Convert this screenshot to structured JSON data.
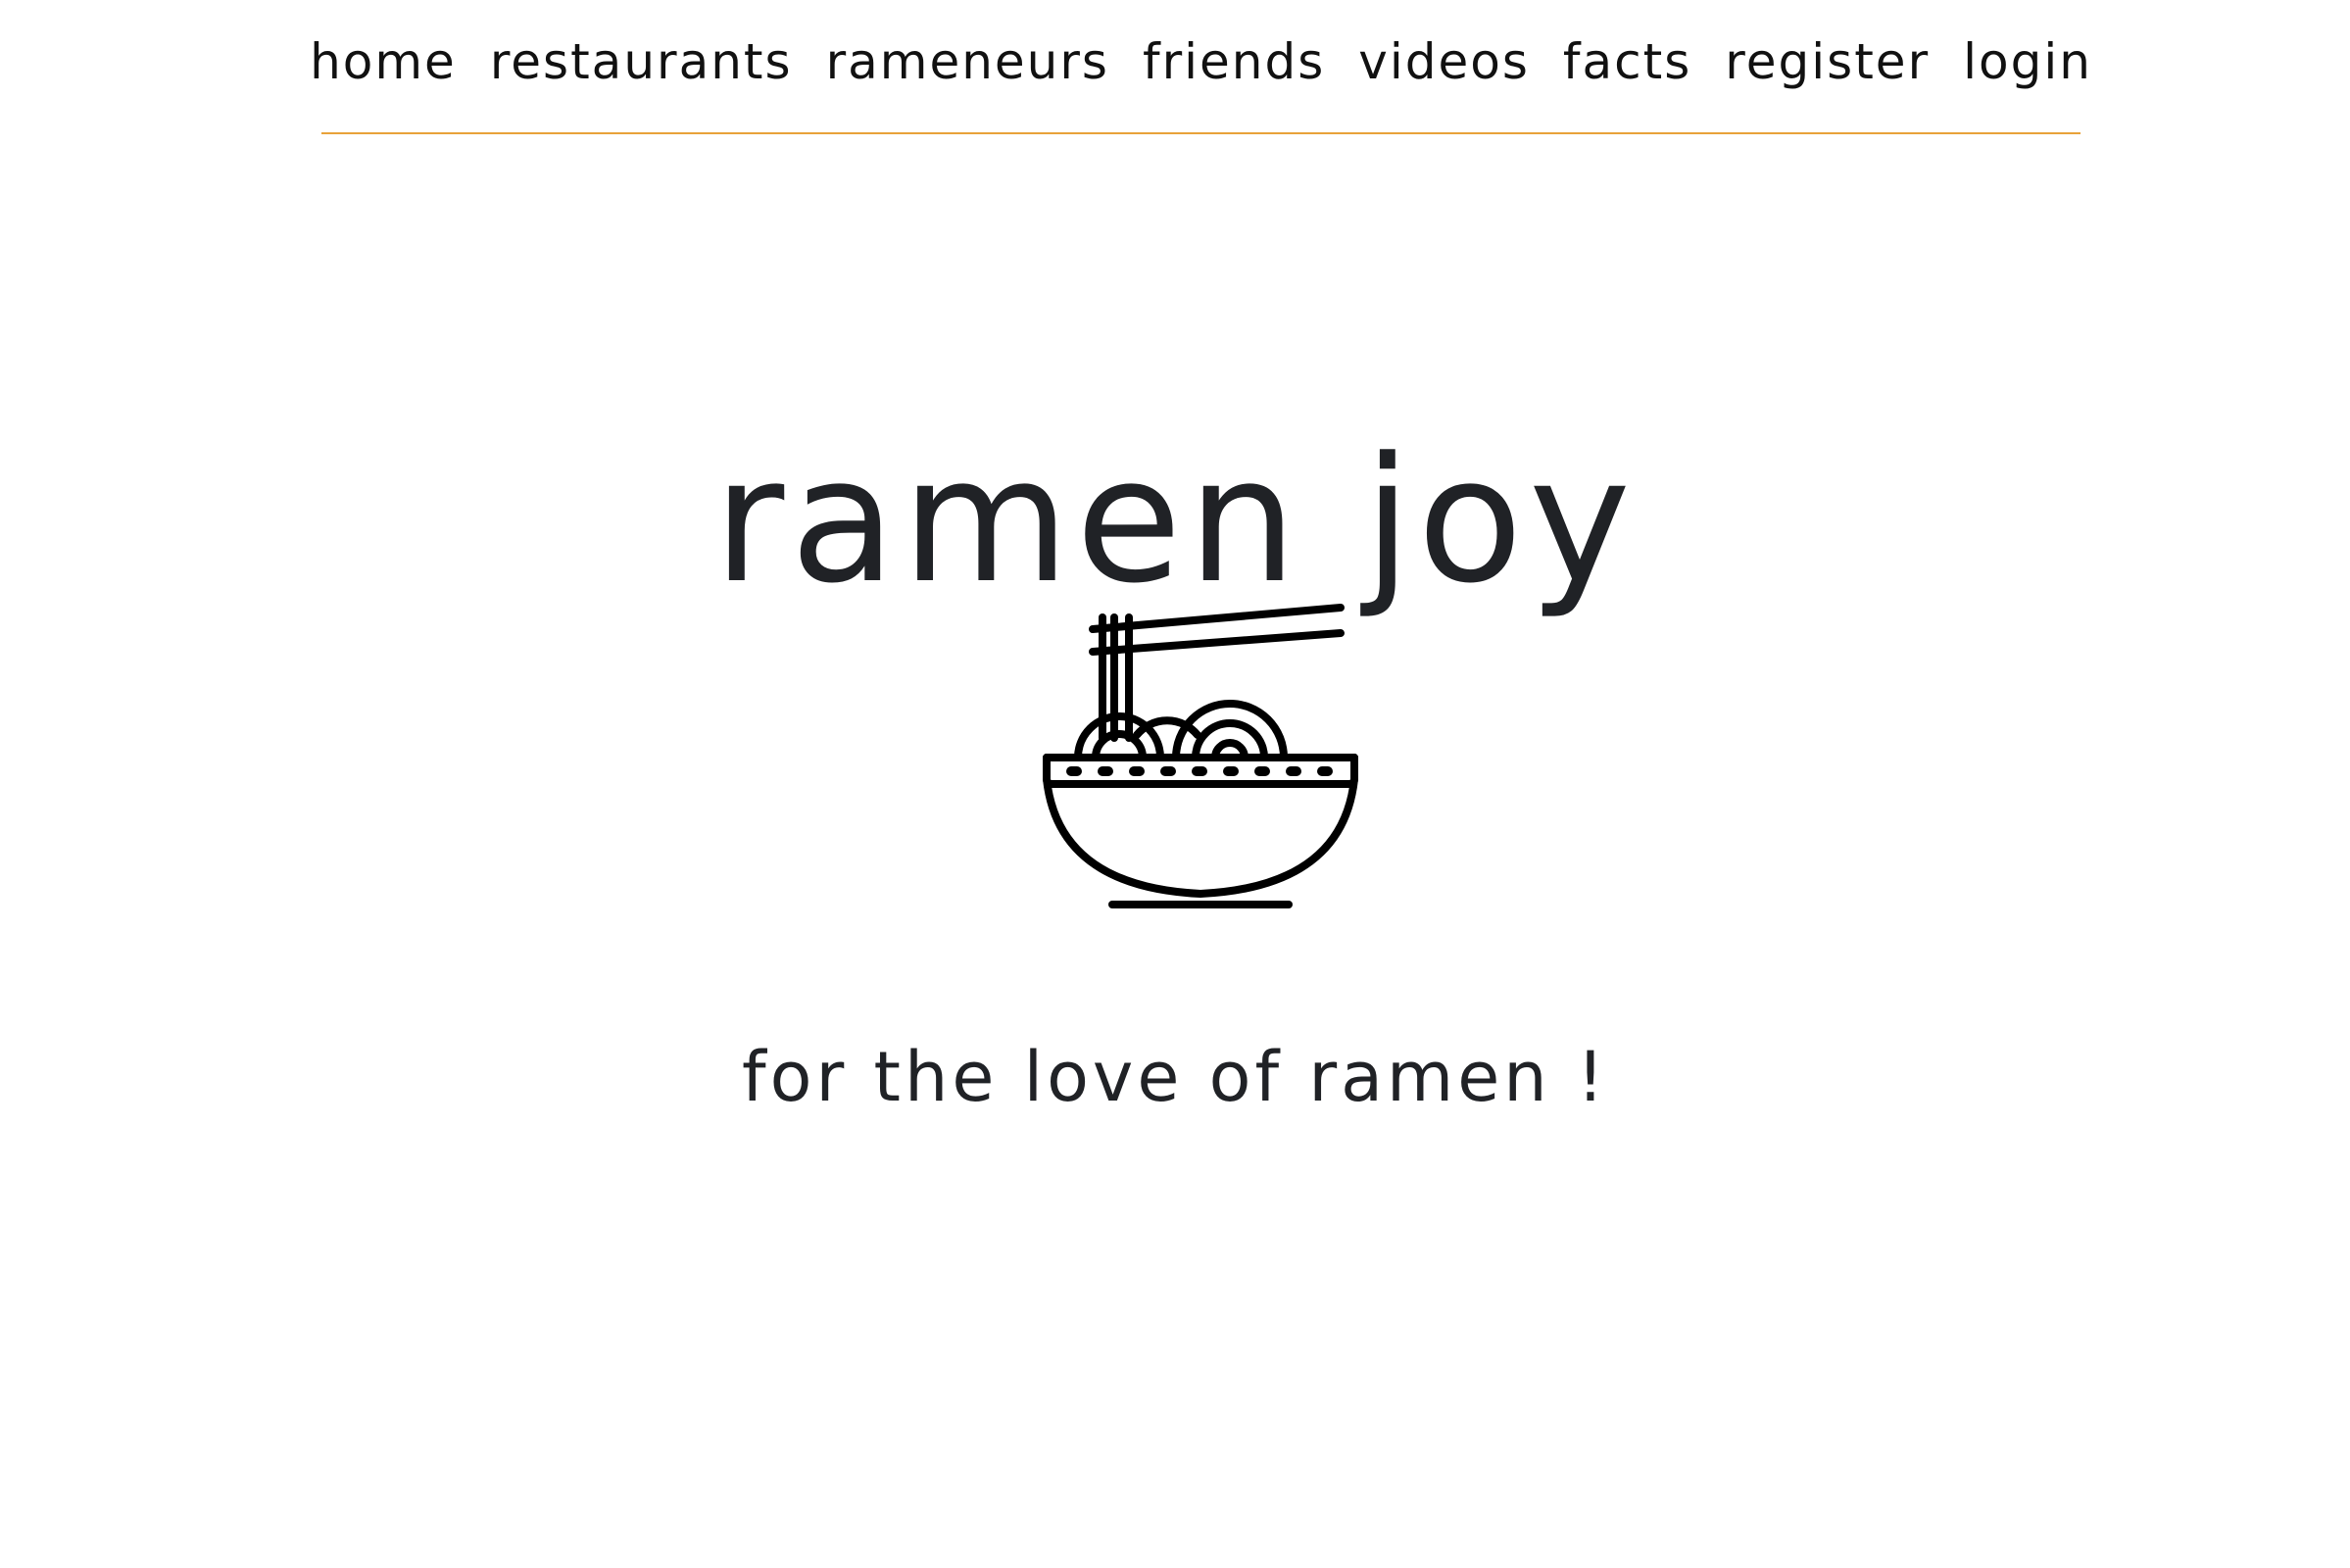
{
  "nav": {
    "items": [
      {
        "label": "home"
      },
      {
        "label": "restaurants"
      },
      {
        "label": "rameneurs"
      },
      {
        "label": "friends"
      },
      {
        "label": "videos"
      },
      {
        "label": "facts"
      },
      {
        "label": "register"
      },
      {
        "label": "login"
      }
    ]
  },
  "hero": {
    "title": "ramen joy",
    "logo_icon": "ramen-bowl-icon",
    "tagline": "for the love of ramen !"
  },
  "colors": {
    "accent_line": "#e8a23a",
    "text": "#202226",
    "background": "#ffffff"
  }
}
